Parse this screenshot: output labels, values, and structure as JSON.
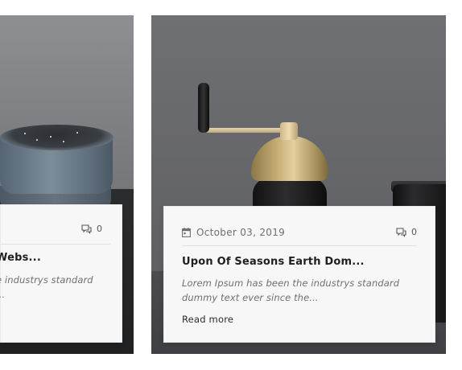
{
  "cards": [
    {
      "comments_count": "0",
      "title": "Webs...",
      "excerpt_line1": "e industrys standard",
      "excerpt_line2": "..."
    },
    {
      "date": "October 03, 2019",
      "comments_count": "0",
      "title": "Upon Of Seasons Earth Dom...",
      "excerpt_line1": "Lorem Ipsum has been the industrys standard",
      "excerpt_line2": "dummy text ever since the...",
      "read_more_label": "Read more"
    }
  ],
  "icons": {
    "date": "calendar-icon",
    "comments": "speech-bubbles-icon"
  }
}
